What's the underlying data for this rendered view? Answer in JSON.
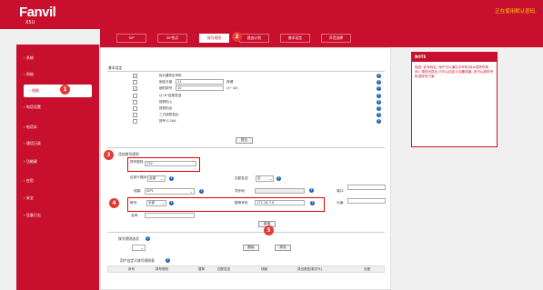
{
  "header": {
    "logo": "Fanvil",
    "model": "X5U",
    "notice": "正在使用默认密码,"
  },
  "tabs": [
    {
      "label": "SIP"
    },
    {
      "label": "SIP热点"
    },
    {
      "label": "拨号规则"
    },
    {
      "label": "路由计划"
    },
    {
      "label": "基本设定"
    },
    {
      "label": "声音选择"
    }
  ],
  "sidebar": {
    "items": [
      {
        "label": "系统"
      },
      {
        "label": "网络"
      },
      {
        "label": "线路"
      },
      {
        "label": "电话设置"
      },
      {
        "label": "电话本"
      },
      {
        "label": "通话记录"
      },
      {
        "label": "功能键"
      },
      {
        "label": "应用"
      },
      {
        "label": "安全"
      },
      {
        "label": "设备日志"
      }
    ]
  },
  "basic": {
    "title": "基本设定",
    "options": [
      {
        "label": "除#键拨出号码",
        "checked": true
      },
      {
        "label": "固定长度",
        "value": "11",
        "suffix": "按键",
        "checked": false
      },
      {
        "label": "超时拨号",
        "value": "10",
        "suffix": "(3~30)",
        "checked": true
      },
      {
        "label": "以\"#\"结尾发送",
        "checked": false
      },
      {
        "label": "按抓拍入",
        "checked": false
      },
      {
        "label": "按抓拍出",
        "checked": false
      },
      {
        "label": "三方按抓拍出",
        "checked": false
      },
      {
        "label": "按号 E.164",
        "checked": false
      }
    ],
    "submit": "提交"
  },
  "add_rule": {
    "title": "添加拨号规则",
    "dial_number_label": "拨号规则:",
    "dial_number_value": "232",
    "rule_type_label": "应用于规则:",
    "rule_type_value": "全部",
    "rule_type2_value": "否",
    "apply_label": "匹配发送:",
    "line_label": "线路:",
    "line_value": "SIP1",
    "sync_label": "同步地:",
    "port_label": "端口:",
    "account_label": "账号:",
    "account_value": "全部",
    "target_label": "替换号码:",
    "target_value": "172.16.7.8",
    "length_label": "长度:",
    "name_label": "名称:",
    "add_button": "新增"
  },
  "rule_list": {
    "title": "拨号规则选项",
    "delete_button": "删除",
    "modify_button": "修改"
  },
  "user_list": {
    "title": "用户自定义拨号规则表",
    "columns": [
      "序号",
      "拨号规则",
      "替换",
      "匹配发送",
      "线路",
      "拨出类型(取字头)",
      "长度"
    ]
  },
  "note": {
    "title": "NOTE",
    "body": "描述: 此号码后, 用户可以通过对号码(除#或拨号规则), 规则为拨出,它可以自定义设置线路, 还可以超时号码或拨号方案"
  },
  "markers": [
    "1",
    "2",
    "3",
    "4",
    "5"
  ],
  "colors": {
    "brand": "#c8102e",
    "marker": "#e53935",
    "help": "#1a5fb4"
  }
}
